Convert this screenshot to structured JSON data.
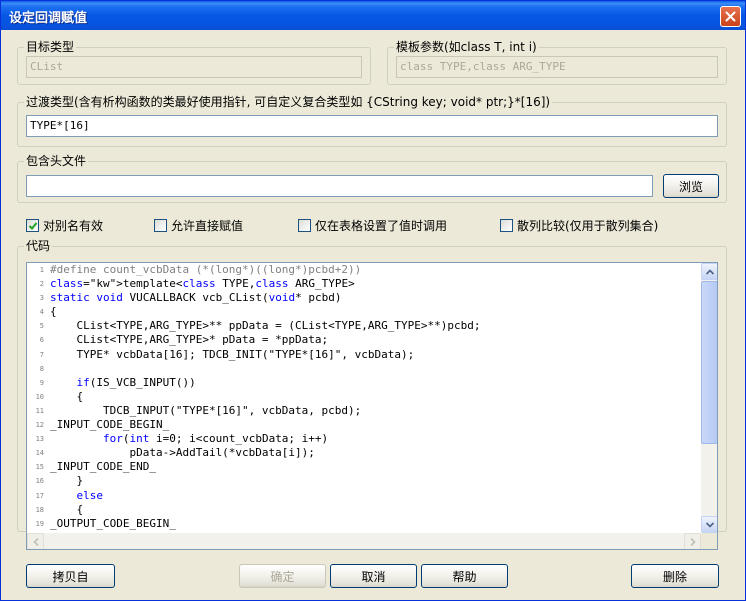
{
  "window": {
    "title": "设定回调赋值"
  },
  "target_type": {
    "label": "目标类型",
    "value": "CList"
  },
  "template_params": {
    "label": "模板参数(如class T, int i)",
    "value": "class TYPE,class ARG_TYPE"
  },
  "transition_type": {
    "label": "过渡类型(含有析构函数的类最好使用指针, 可自定义复合类型如 {CString key; void* ptr;}*[16])",
    "value": "TYPE*[16]"
  },
  "include_files": {
    "label": "包含头文件",
    "value": "",
    "browse_label": "浏览"
  },
  "options": [
    {
      "label": "对别名有效",
      "checked": true
    },
    {
      "label": "允许直接赋值",
      "checked": false
    },
    {
      "label": "仅在表格设置了值时调用",
      "checked": false
    },
    {
      "label": "散列比较(仅用于散列集合)",
      "checked": false
    }
  ],
  "code": {
    "label": "代码",
    "lines": [
      {
        "n": "1",
        "text": "#define count_vcbData (*(long*)((long*)pcbd+2))"
      },
      {
        "n": "2",
        "text": "template<class TYPE,class ARG_TYPE>"
      },
      {
        "n": "3",
        "text": "static void VUCALLBACK vcb_CList(void* pcbd)"
      },
      {
        "n": "4",
        "text": "{"
      },
      {
        "n": "5",
        "text": "    CList<TYPE,ARG_TYPE>** ppData = (CList<TYPE,ARG_TYPE>**)pcbd;"
      },
      {
        "n": "6",
        "text": "    CList<TYPE,ARG_TYPE>* pData = *ppData;"
      },
      {
        "n": "7",
        "text": "    TYPE* vcbData[16]; TDCB_INIT(\"TYPE*[16]\", vcbData);"
      },
      {
        "n": "8",
        "text": ""
      },
      {
        "n": "9",
        "text": "    if(IS_VCB_INPUT())"
      },
      {
        "n": "10",
        "text": "    {"
      },
      {
        "n": "11",
        "text": "        TDCB_INPUT(\"TYPE*[16]\", vcbData, pcbd);"
      },
      {
        "n": "12",
        "text": "_INPUT_CODE_BEGIN_"
      },
      {
        "n": "13",
        "text": "        for(int i=0; i<count_vcbData; i++)"
      },
      {
        "n": "14",
        "text": "            pData->AddTail(*vcbData[i]);"
      },
      {
        "n": "15",
        "text": "_INPUT_CODE_END_"
      },
      {
        "n": "16",
        "text": "    }"
      },
      {
        "n": "17",
        "text": "    else"
      },
      {
        "n": "18",
        "text": "    {"
      },
      {
        "n": "19",
        "text": "_OUTPUT_CODE_BEGIN_"
      }
    ]
  },
  "buttons": {
    "copy_from": "拷贝自",
    "ok": "确定",
    "cancel": "取消",
    "help": "帮助",
    "delete": "删除"
  }
}
